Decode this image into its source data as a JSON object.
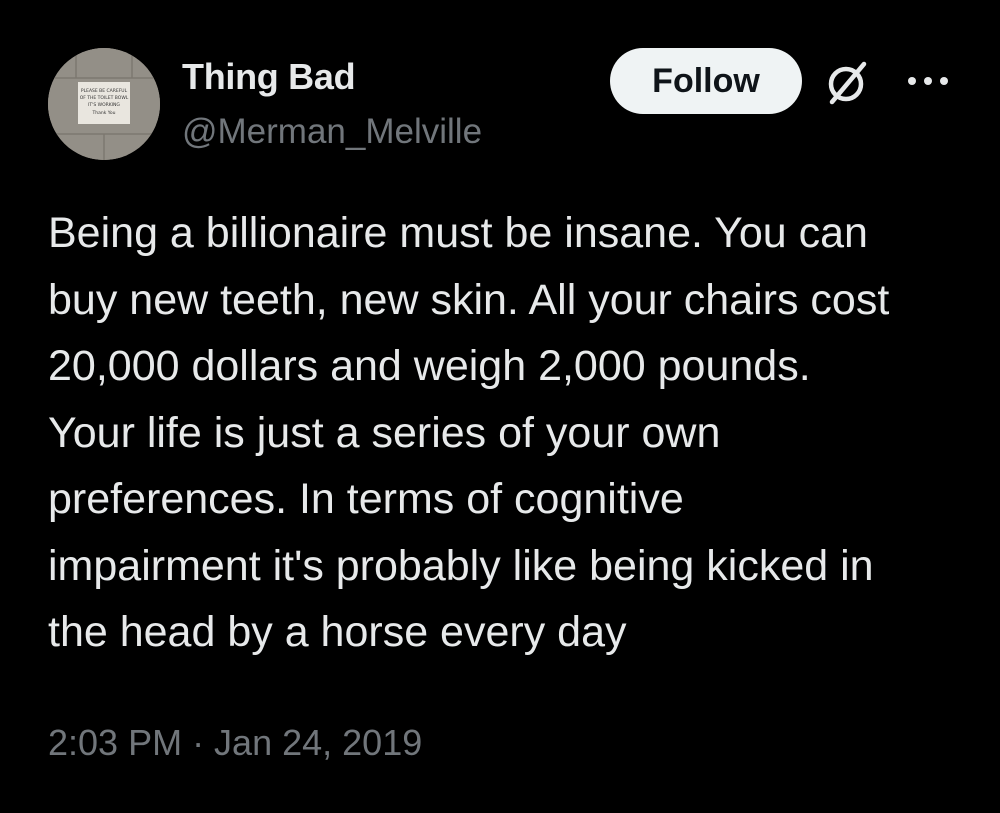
{
  "author": {
    "display_name": "Thing Bad",
    "handle": "@Merman_Melville",
    "avatar_sign_text": [
      "PLEASE BE CAREFUL",
      "OF THE TOILET BOWL",
      "IT'S WORKING",
      "Thank You"
    ]
  },
  "actions": {
    "follow_label": "Follow",
    "grok_icon": "grok-slash-icon",
    "more_icon": "more-dots-icon"
  },
  "tweet": {
    "lines": [
      "Being a billionaire must be insane. You can",
      "buy new teeth, new skin. All your chairs cost",
      "20,000 dollars and weigh 2,000 pounds.",
      "Your life is just a series of your own",
      "preferences. In terms of cognitive",
      "impairment it's probably like being kicked in",
      "the head by a horse every day"
    ],
    "timestamp": "2:03 PM · Jan 24, 2019"
  },
  "colors": {
    "background": "#000000",
    "text_primary": "#e7e9ea",
    "text_secondary": "#71767b",
    "follow_bg": "#eff3f4",
    "follow_text": "#0f1419"
  }
}
